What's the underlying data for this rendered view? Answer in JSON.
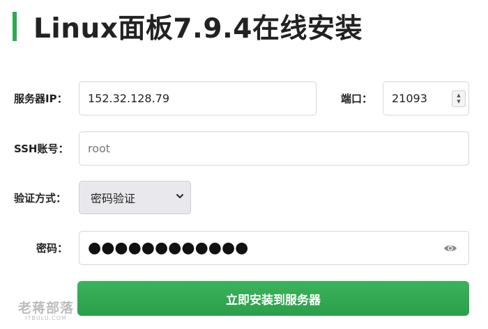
{
  "page": {
    "title": "Linux面板7.9.4在线安装"
  },
  "form": {
    "server_ip": {
      "label": "服务器IP：",
      "value": "152.32.128.79"
    },
    "port": {
      "label": "端口：",
      "value": "21093"
    },
    "ssh_account": {
      "label": "SSH账号：",
      "placeholder": "root"
    },
    "auth_method": {
      "label": "验证方式：",
      "selected": "密码验证"
    },
    "password": {
      "label": "密码：",
      "masked_value": "●●●●●●●●●●●●"
    },
    "submit_label": "立即安装到服务器"
  },
  "watermark": {
    "text": "老蒋部落",
    "subtext": "ITBULU.COM"
  },
  "colors": {
    "accent": "#2eaa4f",
    "button": "#34a853"
  },
  "icons": {
    "select_arrow": "chevron-down-icon",
    "password_toggle": "eye-icon",
    "port_stepper": "stepper-icon"
  }
}
